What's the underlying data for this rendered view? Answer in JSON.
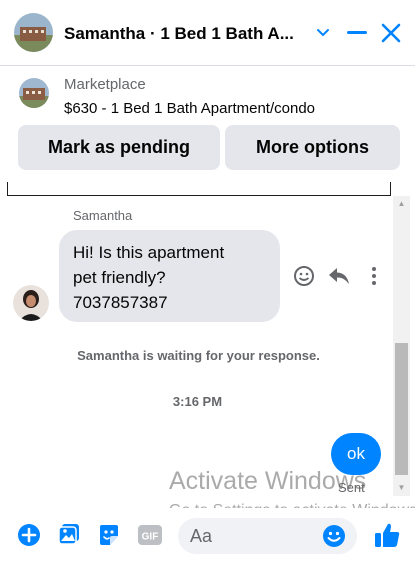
{
  "header": {
    "title": "Samantha · 1 Bed 1 Bath A...",
    "chevron_icon": "chevron-down-icon",
    "minimize_icon": "minimize-icon",
    "close_icon": "close-icon"
  },
  "marketplace": {
    "label": "Marketplace",
    "listing": "$630 - 1 Bed 1 Bath Apartment/condo",
    "pending_button": "Mark as pending",
    "options_button": "More options"
  },
  "conversation": {
    "sender_name": "Samantha",
    "incoming_message": [
      "Hi! Is this apartment",
      "pet friendly?",
      "7037857387"
    ],
    "waiting_notice": "Samantha is waiting for your response.",
    "timestamp": "3:16 PM",
    "outgoing_message": "ok",
    "delivery_status": "Sent"
  },
  "composer": {
    "placeholder": "Aa",
    "gif_label": "GIF"
  },
  "watermark": {
    "line1": "Activate Windows",
    "line2": "Go to Settings to activate Windows."
  },
  "colors": {
    "accent": "#0084ff",
    "bubble_gray": "#e4e6eb",
    "secondary_text": "#65676b"
  }
}
